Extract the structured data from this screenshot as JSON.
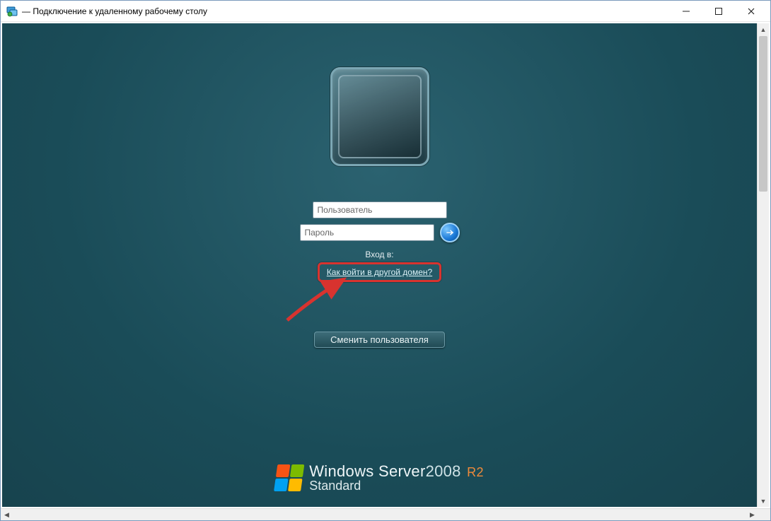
{
  "window": {
    "title": " — Подключение к удаленному рабочему столу"
  },
  "login": {
    "username_placeholder": "Пользователь",
    "password_placeholder": "Пароль",
    "login_to_label": "Вход в:",
    "other_domain_link": "Как войти в другой домен?",
    "switch_user": "Сменить пользователя"
  },
  "branding": {
    "product": "Windows Server",
    "year": "2008",
    "suffix": "R2",
    "edition": "Standard"
  }
}
